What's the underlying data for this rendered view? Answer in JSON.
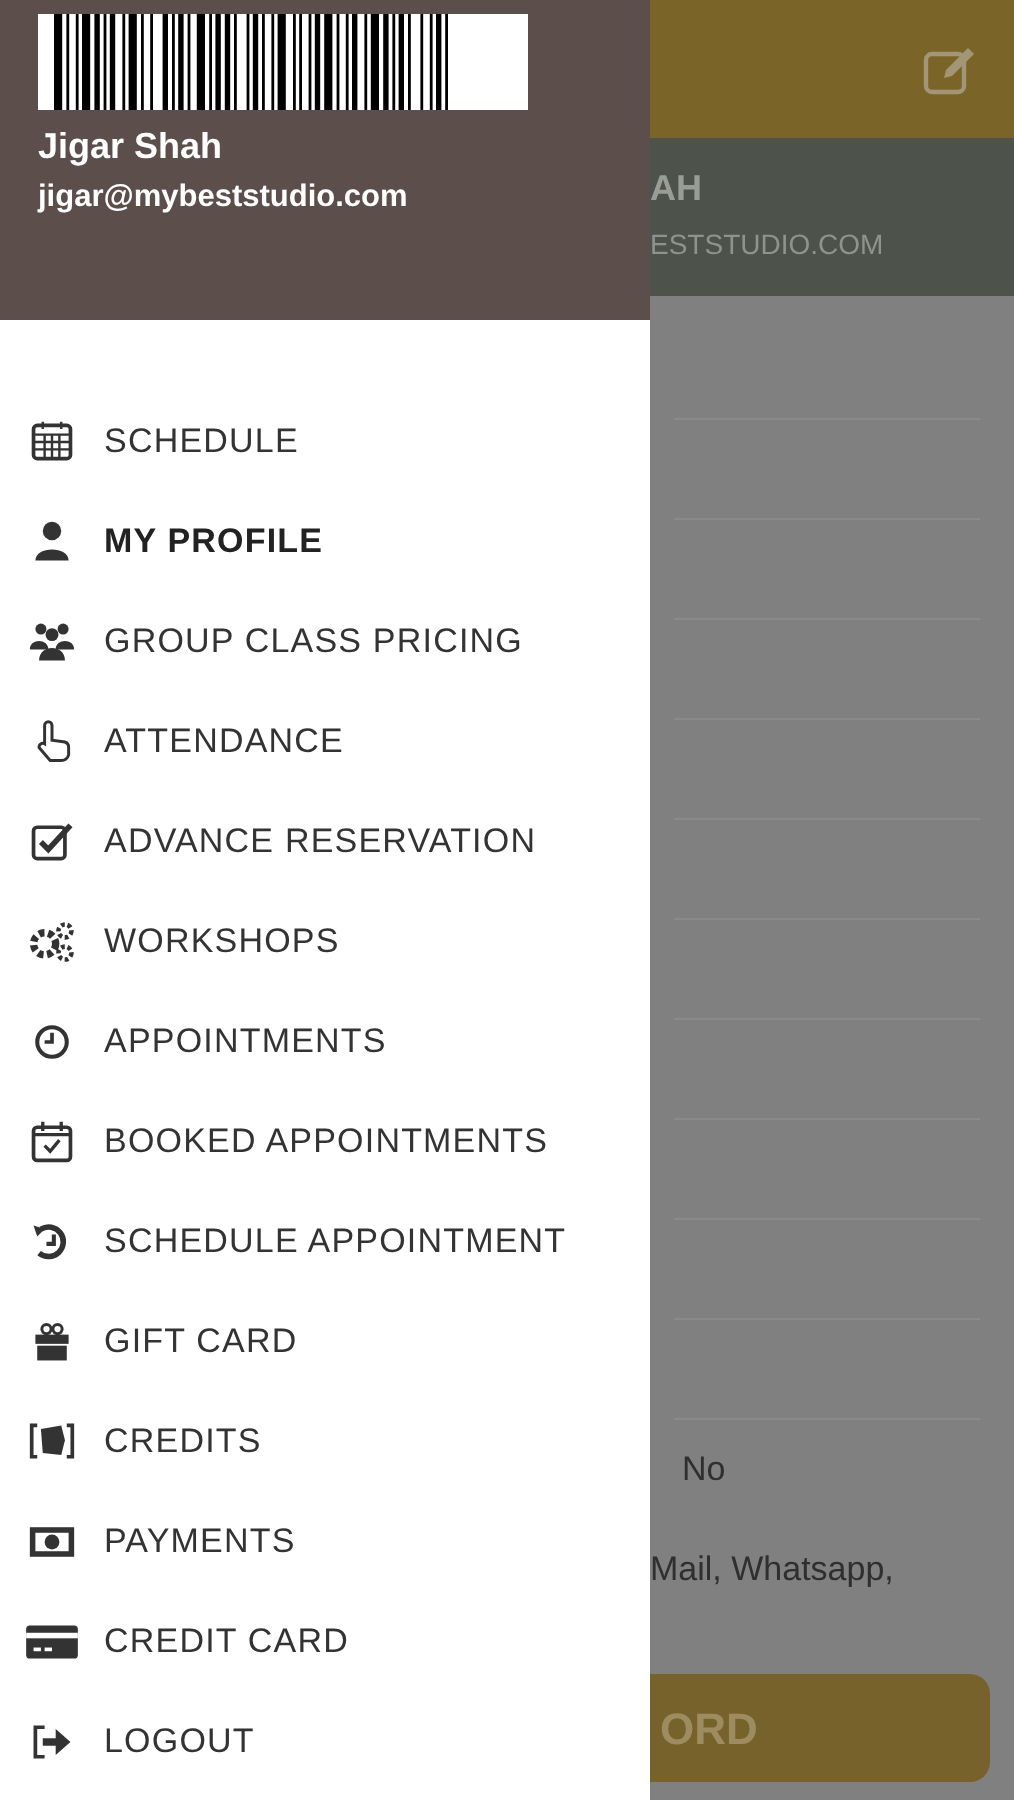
{
  "drawer": {
    "user_name": "Jigar Shah",
    "user_email": "jigar@mybeststudio.com",
    "menu": [
      {
        "label": "SCHEDULE",
        "selected": false
      },
      {
        "label": "MY PROFILE",
        "selected": true
      },
      {
        "label": "GROUP CLASS PRICING",
        "selected": false
      },
      {
        "label": "ATTENDANCE",
        "selected": false
      },
      {
        "label": "ADVANCE RESERVATION",
        "selected": false
      },
      {
        "label": "WORKSHOPS",
        "selected": false
      },
      {
        "label": "APPOINTMENTS",
        "selected": false
      },
      {
        "label": "BOOKED APPOINTMENTS",
        "selected": false
      },
      {
        "label": "SCHEDULE APPOINTMENT",
        "selected": false
      },
      {
        "label": "GIFT CARD",
        "selected": false
      },
      {
        "label": "CREDITS",
        "selected": false
      },
      {
        "label": "PAYMENTS",
        "selected": false
      },
      {
        "label": "CREDIT CARD",
        "selected": false
      },
      {
        "label": "LOGOUT",
        "selected": false
      }
    ]
  },
  "background_page": {
    "profile_name": "AH",
    "profile_email": "ESTSTUDIO.COM",
    "field_value": "No",
    "field_text": "Mail, Whatsapp,",
    "button": "ORD"
  }
}
